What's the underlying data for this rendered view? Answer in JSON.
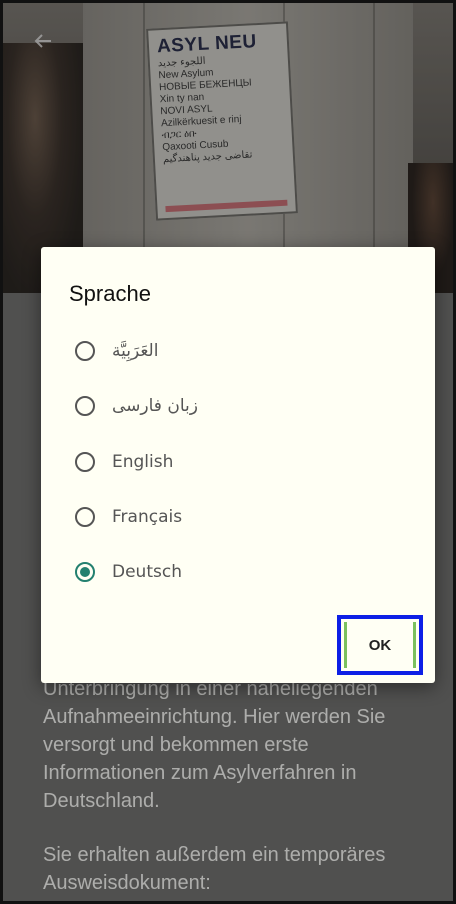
{
  "header": {
    "back_icon": "arrow-left-icon",
    "sign": {
      "title": "ASYL NEU",
      "lines": [
        "اللجوء جديد",
        "New Asylum",
        "НОВЫЕ БЕЖЕНЦЫ",
        "Xin ty nan",
        "NOVI ASYL",
        "Azilkërkuesit e rinj",
        "ብጋር ዕቡ",
        "Qaxooti Cusub",
        "تقاضی جدید پناهندگیم"
      ]
    }
  },
  "dialog": {
    "title": "Sprache",
    "options": [
      {
        "label": "العَرَبِيَّة",
        "selected": false
      },
      {
        "label": "زبان فارسی",
        "selected": false
      },
      {
        "label": "English",
        "selected": false
      },
      {
        "label": "Français",
        "selected": false
      },
      {
        "label": "Deutsch",
        "selected": true
      }
    ],
    "ok_label": "OK"
  },
  "content": {
    "paragraph1": "Unterbringung in einer naheliegenden Aufnahmeeinrichtung. Hier werden Sie versorgt und bekommen erste Informationen zum Asylverfahren in Deutschland.",
    "paragraph2": "Sie erhalten außerdem ein temporäres Ausweisdokument:"
  },
  "colors": {
    "accent": "#23806f",
    "highlight_border": "#0d1fe6",
    "highlight_inner": "#7cc15f"
  }
}
